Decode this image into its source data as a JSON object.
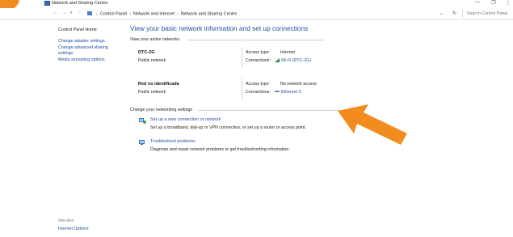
{
  "window": {
    "title": "Network and Sharing Centre",
    "minimize": "—",
    "maximize": "❐",
    "close": "⋮"
  },
  "addressbar": {
    "breadcrumb": [
      "Control Panel",
      "Network and Internet",
      "Network and Sharing Centre"
    ],
    "search_placeholder": "Search Control Panel"
  },
  "sidebar": {
    "home": "Control Panel Home",
    "items": [
      {
        "label": "Change adapter settings"
      },
      {
        "label": "Change advanced sharing"
      },
      {
        "label": "settings"
      },
      {
        "label": "Media streaming options"
      }
    ],
    "see_also_title": "See also",
    "see_also_items": [
      {
        "label": "Internet Options"
      }
    ]
  },
  "main": {
    "title": "View your basic network information and set up connections",
    "active_networks_header": "View your active networks",
    "networks": [
      {
        "name": "DTC-2G",
        "type": "Public network",
        "access_label": "Access type:",
        "access_value": "Internet",
        "conn_label": "Connections:",
        "conn_value": "Wi-Fi (DTC-2G)",
        "conn_icon": "wifi-icon"
      },
      {
        "name": "Red no identificada",
        "type": "Public network",
        "access_label": "Access type:",
        "access_value": "No network access",
        "conn_label": "Connections:",
        "conn_value": "Ethernet 3",
        "conn_icon": "ethernet-icon"
      }
    ],
    "settings_header": "Change your networking settings",
    "tasks": [
      {
        "link": "Set up a new connection or network",
        "desc": "Set up a broadband, dial-up or VPN connection, or set up a router or access point.",
        "icon": "new-connection-icon"
      },
      {
        "link": "Troubleshoot problems",
        "desc": "Diagnose and repair network problems or get troubleshooting information.",
        "icon": "troubleshoot-icon"
      }
    ]
  },
  "colors": {
    "link": "#1f4fa3",
    "arrow": "#f28c1e"
  }
}
